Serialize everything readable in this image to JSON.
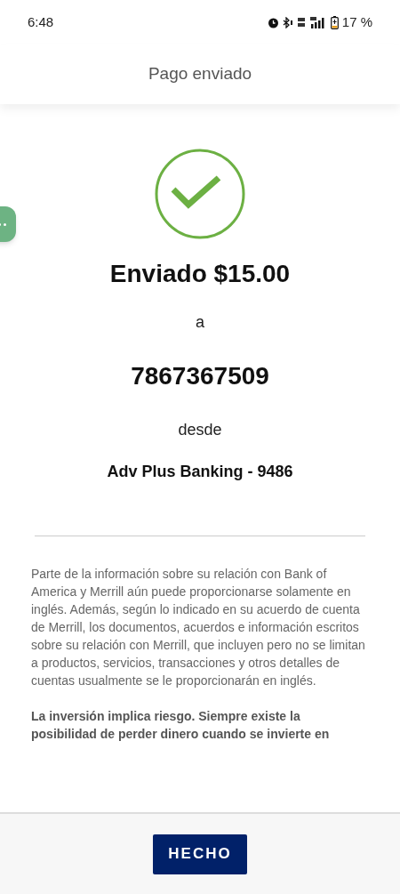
{
  "status_bar": {
    "time": "6:48",
    "battery": "17 %"
  },
  "header": {
    "title": "Pago enviado"
  },
  "confirmation": {
    "amount_line": "Enviado $15.00",
    "to_label": "a",
    "recipient": "7867367509",
    "from_label": "desde",
    "account": "Adv Plus Banking - 9486"
  },
  "disclosures": [
    {
      "kind": "normal",
      "text": "Parte de la información sobre su relación con Bank of America y Merrill aún puede proporcionarse solamente en inglés. Además, según lo indicado en su acuerdo de cuenta de Merrill, los documentos, acuerdos e información escritos sobre su relación con Merrill, que incluyen pero no se limitan a productos, servicios, transacciones y otros detalles de cuentas usualmente se le proporcionarán en inglés."
    },
    {
      "kind": "bold",
      "text": "La inversión implica riesgo. Siempre existe la posibilidad de perder dinero cuando se invierte en"
    }
  ],
  "footer": {
    "button": "HECHO"
  }
}
